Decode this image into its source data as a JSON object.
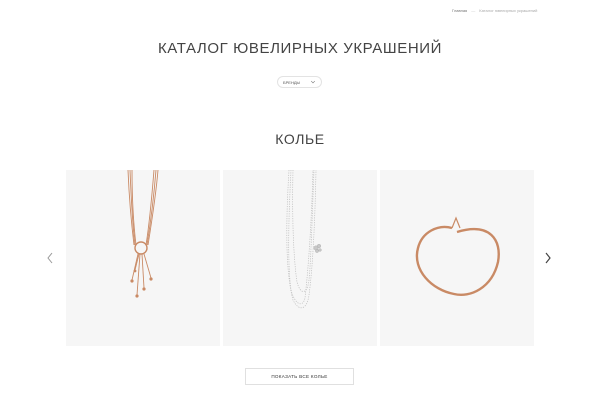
{
  "breadcrumb": {
    "home": "Главная",
    "separator": "—",
    "current": "Каталог ювелирных украшений"
  },
  "page_title": "КАТАЛОГ ЮВЕЛИРНЫХ УКРАШЕНИЙ",
  "brand_filter": {
    "label": "БРЕНДЫ",
    "icon": "chevron-down-icon"
  },
  "section_title": "КОЛЬЕ",
  "carousel": {
    "prev_icon": "chevron-left-icon",
    "next_icon": "chevron-right-icon",
    "products": [
      {
        "image": "rose-gold-lariat-necklace-image"
      },
      {
        "image": "white-gold-multistrand-necklace-image"
      },
      {
        "image": "rose-gold-collar-necklace-image"
      }
    ]
  },
  "show_all_button": "ПОКАЗАТЬ ВСЕ КОЛЬЕ",
  "colors": {
    "rose_gold": "#c98a65",
    "white_gold": "#bdbdbd",
    "card_bg": "#f6f6f6"
  }
}
